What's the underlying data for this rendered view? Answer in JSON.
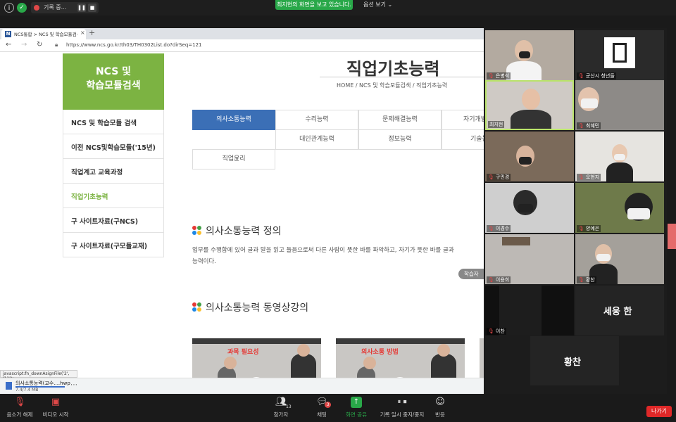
{
  "zoom_top": {
    "recording_text": "기록 중...",
    "share_banner": "최지현의 화면을 보고 있습니다.",
    "view_options": "옵션 보기 ⌄"
  },
  "browser": {
    "tab_title": "NCS통합 > NCS 및 학습모듈검색 >",
    "url": "https://www.ncs.go.kr/th03/TH0302List.do?dirSeq=121"
  },
  "page": {
    "title": "직업기초능력",
    "breadcrumb": "HOME / NCS 및 학습모듈검색 / 직업기초능력",
    "sidebar_header_line1": "NCS 및",
    "sidebar_header_line2": "학습모듈검색",
    "sidebar_items": [
      "NCS 및 학습모듈 검색",
      "이전 NCS및학습모듈('15년)",
      "직업계고 교육과정",
      "직업기초능력",
      "구 사이트자료(구NCS)",
      "구 사이트자료(구모듈교재)"
    ],
    "tabs": [
      "의사소통능력",
      "수리능력",
      "문제해결능력",
      "자기개발능력",
      "대인관계능력",
      "정보능력",
      "기술능력",
      "직업윤리"
    ],
    "section1_title": "의사소통능력 정의",
    "section1_text_line1": "업무를 수행함에 있어 글과 말을 읽고 들음으로써 다른 사람이 뜻한 바를 파악하고, 자기가 뜻한 바를 글과",
    "section1_text_line2": "능력이다.",
    "learn_button": "학습자",
    "section2_title": "의사소통능력 동영상강의",
    "video1_heading": "과목 필요성",
    "video2_heading": "의사소통 방법"
  },
  "status_url": "javascript:fn_downAsignFile('2', '11');",
  "download": {
    "filename": "의사소통능력(교수....hwp",
    "size": "7.4/7.4 MB"
  },
  "gallery": {
    "tiles": [
      "은병석",
      "군산시 청년들",
      "최지현",
      "최혜민",
      "구민경",
      "오현지",
      "이경수",
      "양예은",
      "이용희",
      "황찬",
      "이찬",
      "세웅 한"
    ],
    "bottom_tile": "황찬"
  },
  "toolbar": {
    "unmute": "음소거 해제",
    "video_start": "비디오 시작",
    "participants": "참가자",
    "participants_count": "13",
    "chat": "채팅",
    "chat_badge": "3",
    "share": "화면 공유",
    "pause_record": "기록 일시 중지/중지",
    "reactions": "반응",
    "leave": "나가기"
  },
  "colors": {
    "sidebar_green": "#7cb342",
    "tab_active": "#3b6fb6",
    "zoom_green": "#29a849",
    "leave_red": "#e02828"
  }
}
